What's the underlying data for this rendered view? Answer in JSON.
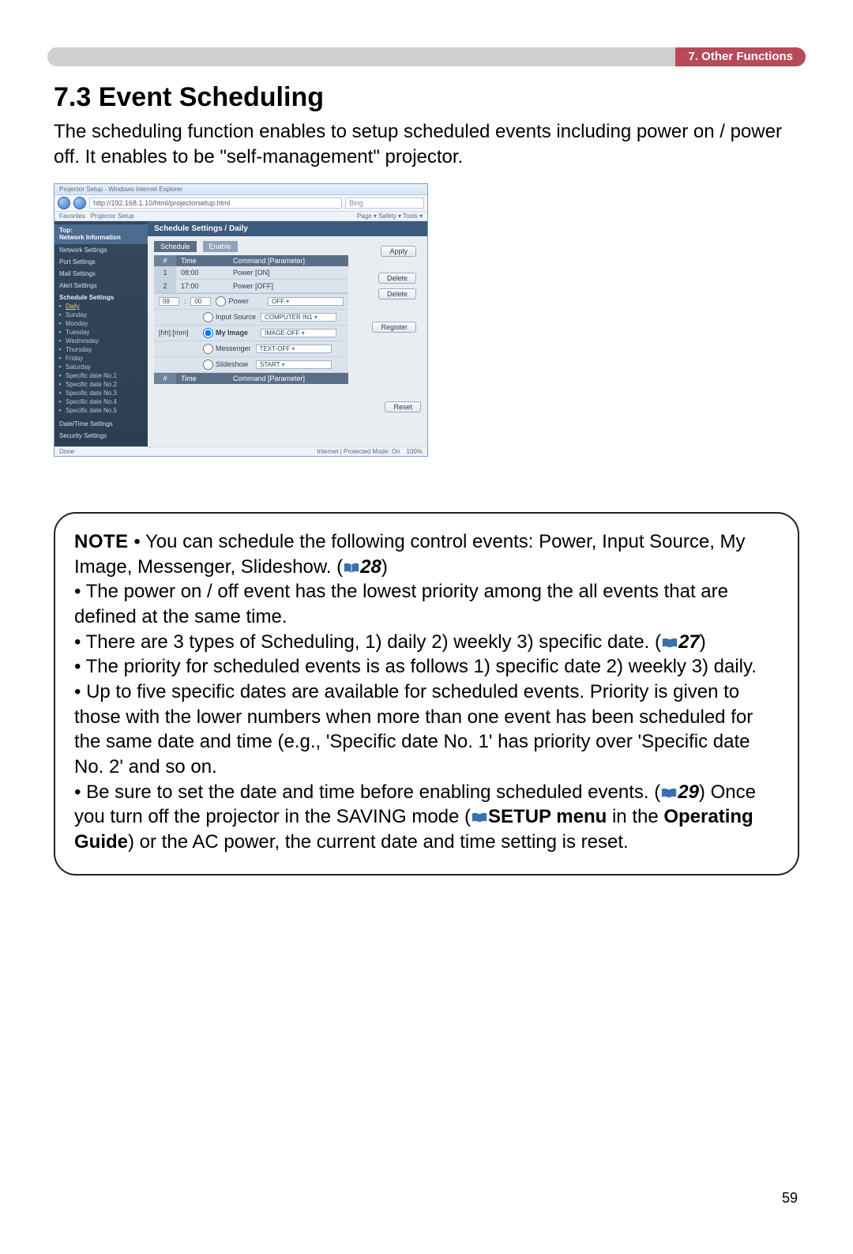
{
  "header": {
    "label": "7. Other Functions"
  },
  "title": "7.3 Event Scheduling",
  "intro": "The scheduling function enables to setup scheduled events including power on / power off. It enables to be \"self-management\" projector.",
  "shot": {
    "titlebar": "Projector Setup - Windows Internet Explorer",
    "address": "http://192.168.1.10/html/projectorsetup.html",
    "search_placeholder": "Bing",
    "favorites": "Favorites",
    "tab": "Projector Setup",
    "toolbar_right": "Page ▾  Safety ▾  Tools ▾",
    "sidebar": {
      "top1": "Top:",
      "top2": "Network Information",
      "items": [
        "Network Settings",
        "Port Settings",
        "Mail Settings",
        "Alert Settings"
      ],
      "sched_header": "Schedule Settings",
      "sched_items": [
        "Daily",
        "Sunday",
        "Monday",
        "Tuesday",
        "Wednesday",
        "Thursday",
        "Friday",
        "Saturday",
        "Specific date No.1",
        "Specific date No.2",
        "Specific date No.3",
        "Specific date No.4",
        "Specific date No.5"
      ],
      "tail": [
        "Date/Time Settings",
        "Security Settings"
      ]
    },
    "panel_title": "Schedule Settings / Daily",
    "schedule_chip": "Schedule",
    "enable_chip": "Enable",
    "apply": "Apply",
    "th_num": "#",
    "th_time": "Time",
    "th_cmd": "Command [Parameter]",
    "rows": [
      {
        "num": "1",
        "time": "08:00",
        "cmd": "Power [ON]",
        "btn": "Delete"
      },
      {
        "num": "2",
        "time": "17:00",
        "cmd": "Power [OFF]",
        "btn": "Delete"
      }
    ],
    "editor": {
      "hh": "09",
      "mm": "00",
      "reg_time_label": "[hh]:[mm]",
      "power_label": "Power",
      "power_val": "OFF",
      "input_label": "Input Source",
      "input_val": "COMPUTER IN1",
      "myimage_label": "My Image",
      "myimage_val": "IMAGE-OFF",
      "messenger_label": "Messenger",
      "messenger_val": "TEXT-OFF",
      "slideshow_label": "Slideshow",
      "slideshow_val": "START",
      "register": "Register"
    },
    "reset": "Reset",
    "status_left": "Done",
    "status_mid": "Internet | Protected Mode: On",
    "status_zoom": "100%"
  },
  "note": {
    "lead": "NOTE",
    "b1a": " • You can schedule the following control events: Power, Input Source, My Image, Messenger, Slideshow. (",
    "ref1": "28",
    "b1b": ")",
    "b2": "• The power on / off event has the lowest priority among the all events that are defined at the same time.",
    "b3a": "• There are 3 types of Scheduling, 1) daily 2) weekly 3) specific date. (",
    "ref3": "27",
    "b3b": ")",
    "b4": "• The priority for scheduled events is as follows 1) specific date 2) weekly 3) daily.",
    "b5": "• Up to five specific dates are available for scheduled events. Priority is given to those with the lower numbers when more than one event has been scheduled for the same date and time (e.g., 'Specific date No. 1' has priority over 'Specific date No. 2' and so on.",
    "b6a": "• Be sure to set the date and time before enabling scheduled events. (",
    "ref6": "29",
    "b6b": ") Once you turn off the projector in the SAVING mode (",
    "b6c": "SETUP menu",
    "b6d": " in the ",
    "b6e": "Operating Guide",
    "b6f": ") or the AC power, the current date and time setting is reset."
  },
  "page_number": "59"
}
